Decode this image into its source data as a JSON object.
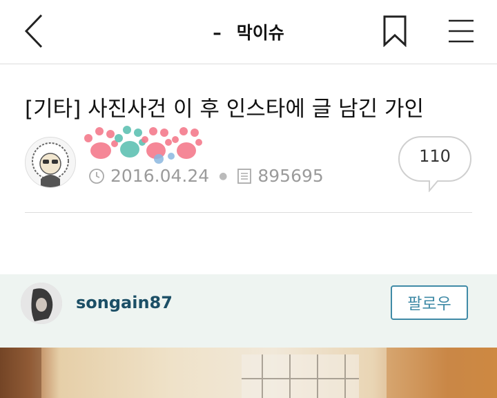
{
  "header": {
    "dash": "–",
    "title": "막이슈"
  },
  "post": {
    "title": "[기타] 사진사건 이 후 인스타에 글 남긴 가인",
    "date": "2016.04.24",
    "views": "895695",
    "comment_count": "110"
  },
  "instagram": {
    "username": "songain87",
    "follow_label": "팔로우"
  },
  "icons": {
    "back": "chevron-left-icon",
    "bookmark": "bookmark-icon",
    "menu": "hamburger-menu-icon",
    "clock": "clock-icon",
    "document": "document-icon",
    "comment": "speech-bubble-icon",
    "paws": "paw-print-decoration"
  },
  "colors": {
    "username": "#1c4f66",
    "follow": "#3f8aa6",
    "meta": "#9b9b9b",
    "paw_pink": "#f47b8c",
    "paw_teal": "#5fc1b3"
  }
}
